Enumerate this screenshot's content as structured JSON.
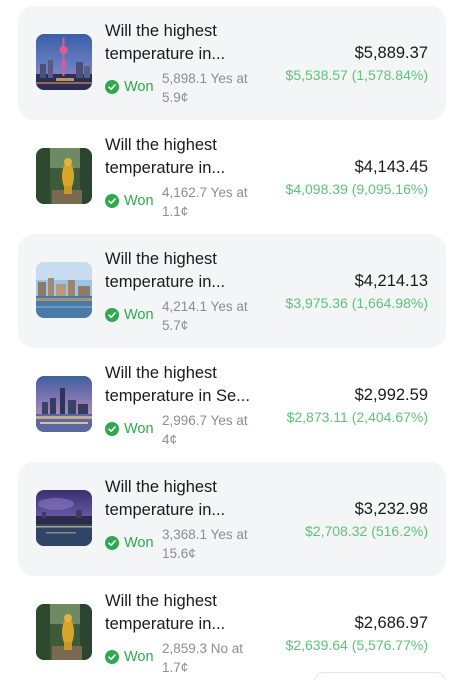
{
  "positions": [
    {
      "title_line1": "Will the highest",
      "title_line2": "temperature in...",
      "status": "Won",
      "shares_line1": "5,898.1 Yes at",
      "shares_line2": "5.9¢",
      "value": "$5,889.37",
      "gain": "$5,538.57 (1,578.84%)",
      "image": "city-skyline-tower-icon"
    },
    {
      "title_line1": "Will the highest",
      "title_line2": "temperature in...",
      "status": "Won",
      "shares_line1": "4,162.7 Yes at",
      "shares_line2": "1.1¢",
      "value": "$4,143.45",
      "gain": "$4,098.39 (9,095.16%)",
      "image": "golden-statue-icon"
    },
    {
      "title_line1": "Will the highest",
      "title_line2": "temperature in...",
      "status": "Won",
      "shares_line1": "4,214.1 Yes at",
      "shares_line2": "5.7¢",
      "value": "$4,214.13",
      "gain": "$3,975.36 (1,664.98%)",
      "image": "waterfront-city-icon"
    },
    {
      "title_line1": "Will the highest",
      "title_line2": "temperature in Se...",
      "status": "Won",
      "shares_line1": "2,996.7 Yes at",
      "shares_line2": "4¢",
      "value": "$2,992.59",
      "gain": "$2,873.11 (2,404.67%)",
      "image": "dusk-skyline-bridge-icon"
    },
    {
      "title_line1": "Will the highest",
      "title_line2": "temperature in...",
      "status": "Won",
      "shares_line1": "3,368.1 Yes at",
      "shares_line2": "15.6¢",
      "value": "$3,232.98",
      "gain": "$2,708.32 (516.2%)",
      "image": "harbor-night-icon"
    },
    {
      "title_line1": "Will the highest",
      "title_line2": "temperature in...",
      "status": "Won",
      "shares_line1": "2,859.3 No at",
      "shares_line2": "1.7¢",
      "value": "$2,686.97",
      "gain": "$2,639.64 (5,576.77%)",
      "image": "golden-statue-icon"
    }
  ],
  "colors": {
    "won_green": "#2fa84f",
    "gain_green": "#5fc277",
    "card_shade": "#f4f5f7",
    "muted_text": "#8a8d93"
  }
}
